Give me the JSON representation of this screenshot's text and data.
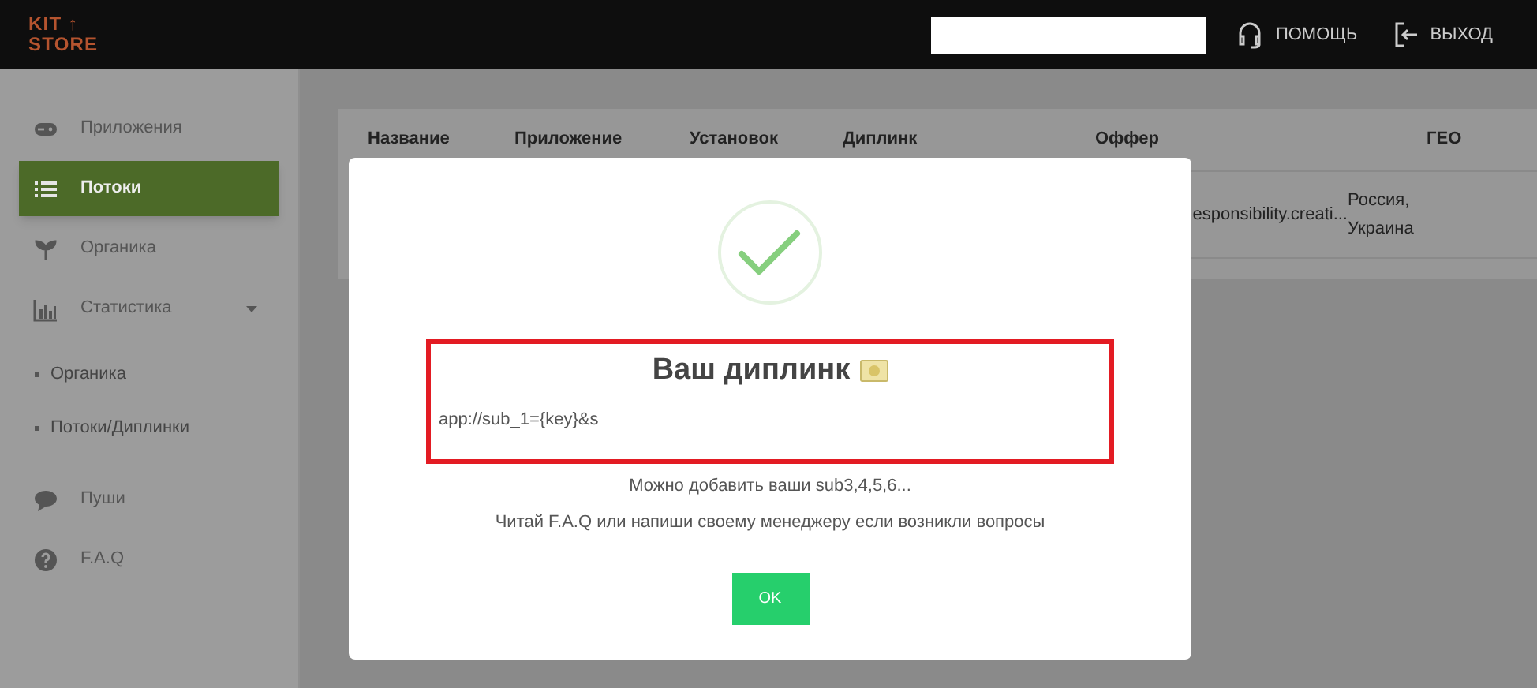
{
  "header": {
    "logo": [
      "KIT ↑",
      "STORE"
    ],
    "help": "ПОМОЩЬ",
    "logout": "ВЫХОД"
  },
  "sidebar": {
    "items": [
      {
        "label": "Приложения",
        "selected": false
      },
      {
        "label": "Потоки",
        "selected": true
      },
      {
        "label": "Органика",
        "selected": false
      },
      {
        "label": "Статистика",
        "selected": false,
        "expanded": true,
        "children": [
          {
            "label": "Органика",
            "selected": false
          },
          {
            "label": "Потоки/Диплинки",
            "selected": false
          }
        ]
      },
      {
        "label": "Пуши",
        "selected": false
      },
      {
        "label": "F.A.Q",
        "selected": false
      }
    ]
  },
  "table": {
    "columns": [
      "Название",
      "Приложение",
      "Установок",
      "Диплинк",
      "Оффер",
      "ГЕО"
    ],
    "rows": [
      [
        "",
        "",
        "",
        "",
        "esponsibility.creati...",
        "Россия, Украина"
      ]
    ]
  },
  "dialog": {
    "title": "Ваш диплинк",
    "deeplink": "app://sub_1={key}&s",
    "hint": "Можно добавить ваши sub3,4,5,6...",
    "note": "Читай F.A.Q или напиши своему менеджеру если возникли вопросы",
    "ok": "OK"
  }
}
